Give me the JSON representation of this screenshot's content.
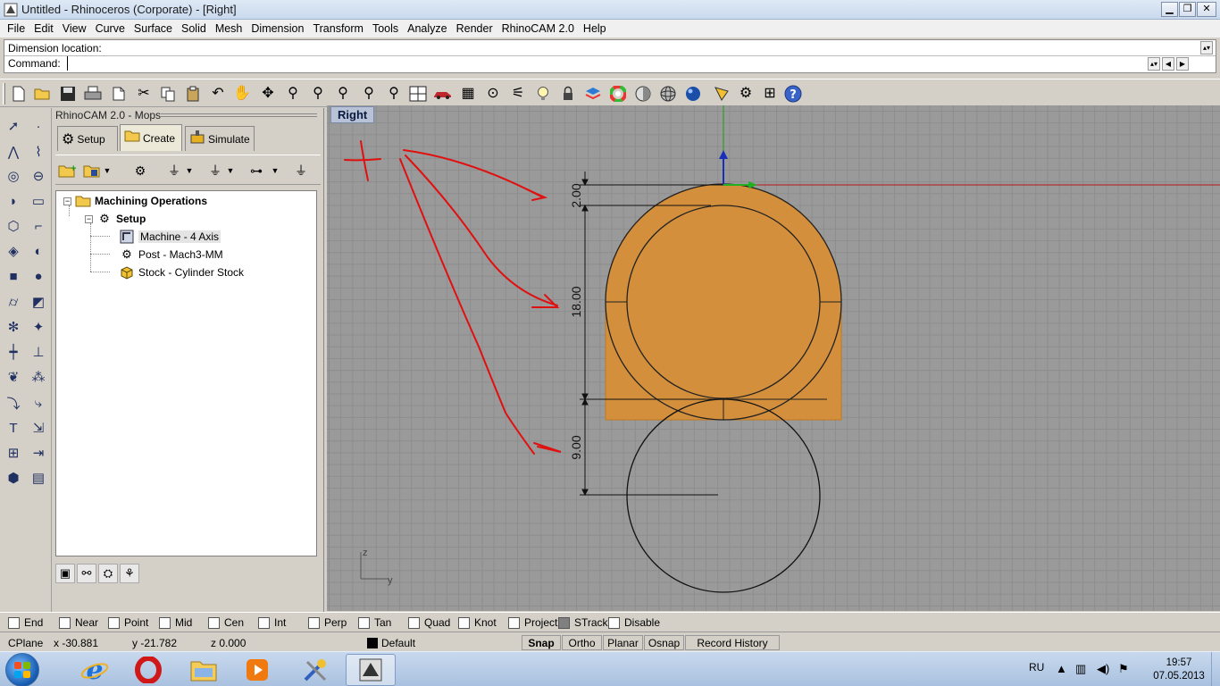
{
  "window": {
    "title": "Untitled - Rhinoceros (Corporate) - [Right]",
    "min_glyph": "▁",
    "restore_glyph": "❐",
    "close_glyph": "✕"
  },
  "menu": [
    "File",
    "Edit",
    "View",
    "Curve",
    "Surface",
    "Solid",
    "Mesh",
    "Dimension",
    "Transform",
    "Tools",
    "Analyze",
    "Render",
    "RhinoCAM 2.0",
    "Help"
  ],
  "command": {
    "history": "Dimension location:",
    "prompt": "Command:",
    "value": ""
  },
  "toolbar_icons": [
    "new-icon",
    "open-icon",
    "save-icon",
    "print-icon",
    "template-icon",
    "cut-icon",
    "copy-icon",
    "paste-icon",
    "undo-icon",
    "pan-hand-icon",
    "rotate-view-icon",
    "zoom-icon",
    "zoom-window-icon",
    "zoom-extents-icon",
    "zoom-selected-icon",
    "zoom-dynamic-icon",
    "undo-view-icon",
    "four-viewports-icon",
    "car-icon",
    "grid-icon",
    "osnap-icon",
    "select-points-icon",
    "light-bulb-icon",
    "lock-icon",
    "layer-icon",
    "color-wheel-icon",
    "shade-icon",
    "render-preview-icon",
    "sphere-icon",
    "named-view-icon",
    "options-icon",
    "help-icon"
  ],
  "left_toolbar_icons": [
    "select-arrow-icon",
    "point-icon",
    "polyline-icon",
    "curve-icon",
    "circle-icon",
    "ellipse-icon",
    "arc-icon",
    "rectangle-icon",
    "polygon-icon",
    "fillet-icon",
    "surface-icon",
    "surface-edit-icon",
    "box-icon",
    "sphere-icon",
    "cylinder-icon",
    "extrude-icon",
    "edit-points-icon",
    "split-icon",
    "trim-icon",
    "join-icon",
    "boolean-icon",
    "group-icon",
    "hide-icon",
    "transform-icon",
    "text-icon",
    "dimension-icon",
    "array-icon",
    "analyze-icon",
    "render-icon",
    "hatch-icon"
  ],
  "panel": {
    "title": "RhinoCAM 2.0 - Mops",
    "tabs": [
      {
        "label": "Setup",
        "icon": "gears-icon"
      },
      {
        "label": "Create",
        "icon": "folder-icon"
      },
      {
        "label": "Simulate",
        "icon": "simulate-icon"
      }
    ],
    "active_tab": "Create",
    "tree": {
      "root": "Machining Operations",
      "setup": "Setup",
      "items": [
        "Machine - 4 Axis",
        "Post - Mach3-MM",
        "Stock - Cylinder Stock"
      ]
    }
  },
  "viewport": {
    "name": "Right",
    "dims": [
      "2.00",
      "18.00",
      "9.00"
    ],
    "axis_vertical": "z",
    "axis_horizontal": "y",
    "stock_color": "#d38f3c",
    "annotation_color": "#e01010"
  },
  "osnap": [
    {
      "label": "End",
      "checked": false
    },
    {
      "label": "Near",
      "checked": false
    },
    {
      "label": "Point",
      "checked": false
    },
    {
      "label": "Mid",
      "checked": false
    },
    {
      "label": "Cen",
      "checked": false
    },
    {
      "label": "Int",
      "checked": false
    },
    {
      "label": "Perp",
      "checked": false
    },
    {
      "label": "Tan",
      "checked": false
    },
    {
      "label": "Quad",
      "checked": false
    },
    {
      "label": "Knot",
      "checked": false
    },
    {
      "label": "Project",
      "checked": false
    },
    {
      "label": "STrack",
      "checked": true
    },
    {
      "label": "Disable",
      "checked": false
    }
  ],
  "status": {
    "cplane": "CPlane",
    "x": "x -30.881",
    "y": "y -21.782",
    "z": "z 0.000",
    "layer": "Default",
    "snap": "Snap",
    "ortho": "Ortho",
    "planar": "Planar",
    "osnap": "Osnap",
    "record_history": "Record History"
  },
  "taskbar": {
    "apps": [
      "ie-icon",
      "opera-icon",
      "explorer-icon",
      "media-player-icon",
      "tools-icon",
      "rhino-icon"
    ],
    "lang": "RU",
    "time": "19:57",
    "date": "07.05.2013"
  }
}
